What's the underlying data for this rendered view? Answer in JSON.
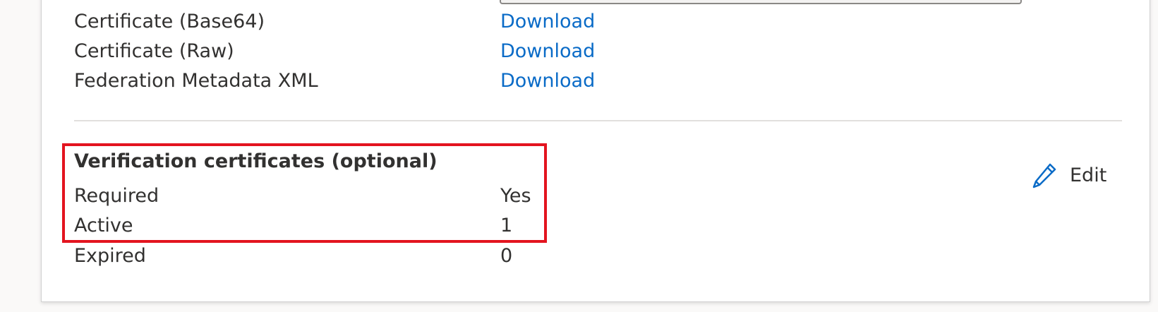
{
  "properties": {
    "rows": [
      {
        "label": "Certificate (Base64)",
        "link": "Download"
      },
      {
        "label": "Certificate (Raw)",
        "link": "Download"
      },
      {
        "label": "Federation Metadata XML",
        "link": "Download"
      }
    ]
  },
  "verification": {
    "title": "Verification certificates (optional)",
    "rows": [
      {
        "label": "Required",
        "value": "Yes"
      },
      {
        "label": "Active",
        "value": "1"
      },
      {
        "label": "Expired",
        "value": "0"
      }
    ],
    "edit_label": "Edit",
    "edit_icon": "pencil-icon"
  },
  "colors": {
    "link": "#0a6bc7",
    "highlight": "#e3141f"
  }
}
